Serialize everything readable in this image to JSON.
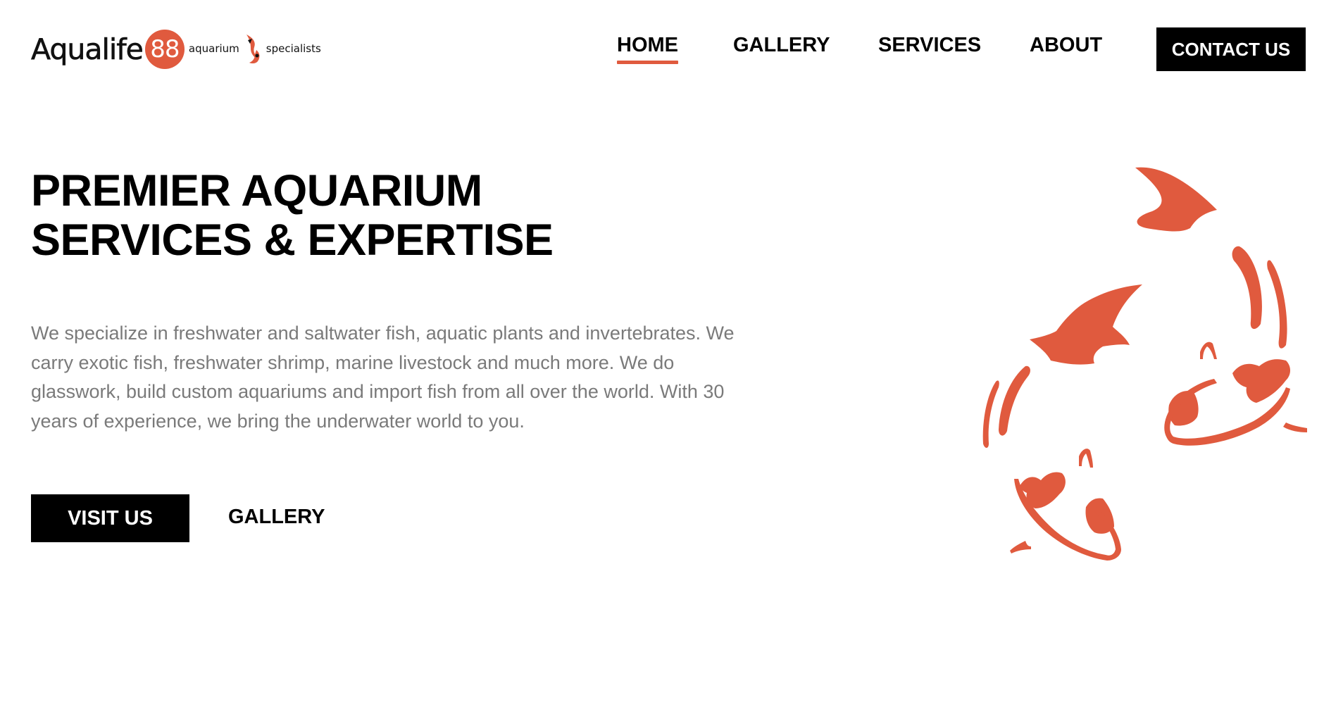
{
  "brand": {
    "name": "Aqualife",
    "badge": "88",
    "tagline_left": "aquarium",
    "tagline_right": "specialists",
    "accent_color": "#e05a3e"
  },
  "nav": {
    "items": [
      {
        "label": "HOME",
        "active": true
      },
      {
        "label": "GALLERY",
        "active": false
      },
      {
        "label": "SERVICES",
        "active": false
      },
      {
        "label": "ABOUT",
        "active": false
      }
    ],
    "contact_label": "CONTACT US"
  },
  "hero": {
    "title_lines": [
      "PREMIER AQUARIUM",
      "SERVICES & EXPERTISE"
    ],
    "description_lines": [
      "We specialize in freshwater and saltwater fish, aquatic plants and invertebrates. We",
      "carry exotic fish, freshwater shrimp, marine livestock and much more. We do",
      "glasswork, build custom aquariums and import fish from all over the world. With 30",
      "years of experience, we bring the underwater world to you."
    ],
    "primary_button": "VISIT US",
    "secondary_link": "GALLERY",
    "illustration": "koi-fish-pair-icon"
  }
}
